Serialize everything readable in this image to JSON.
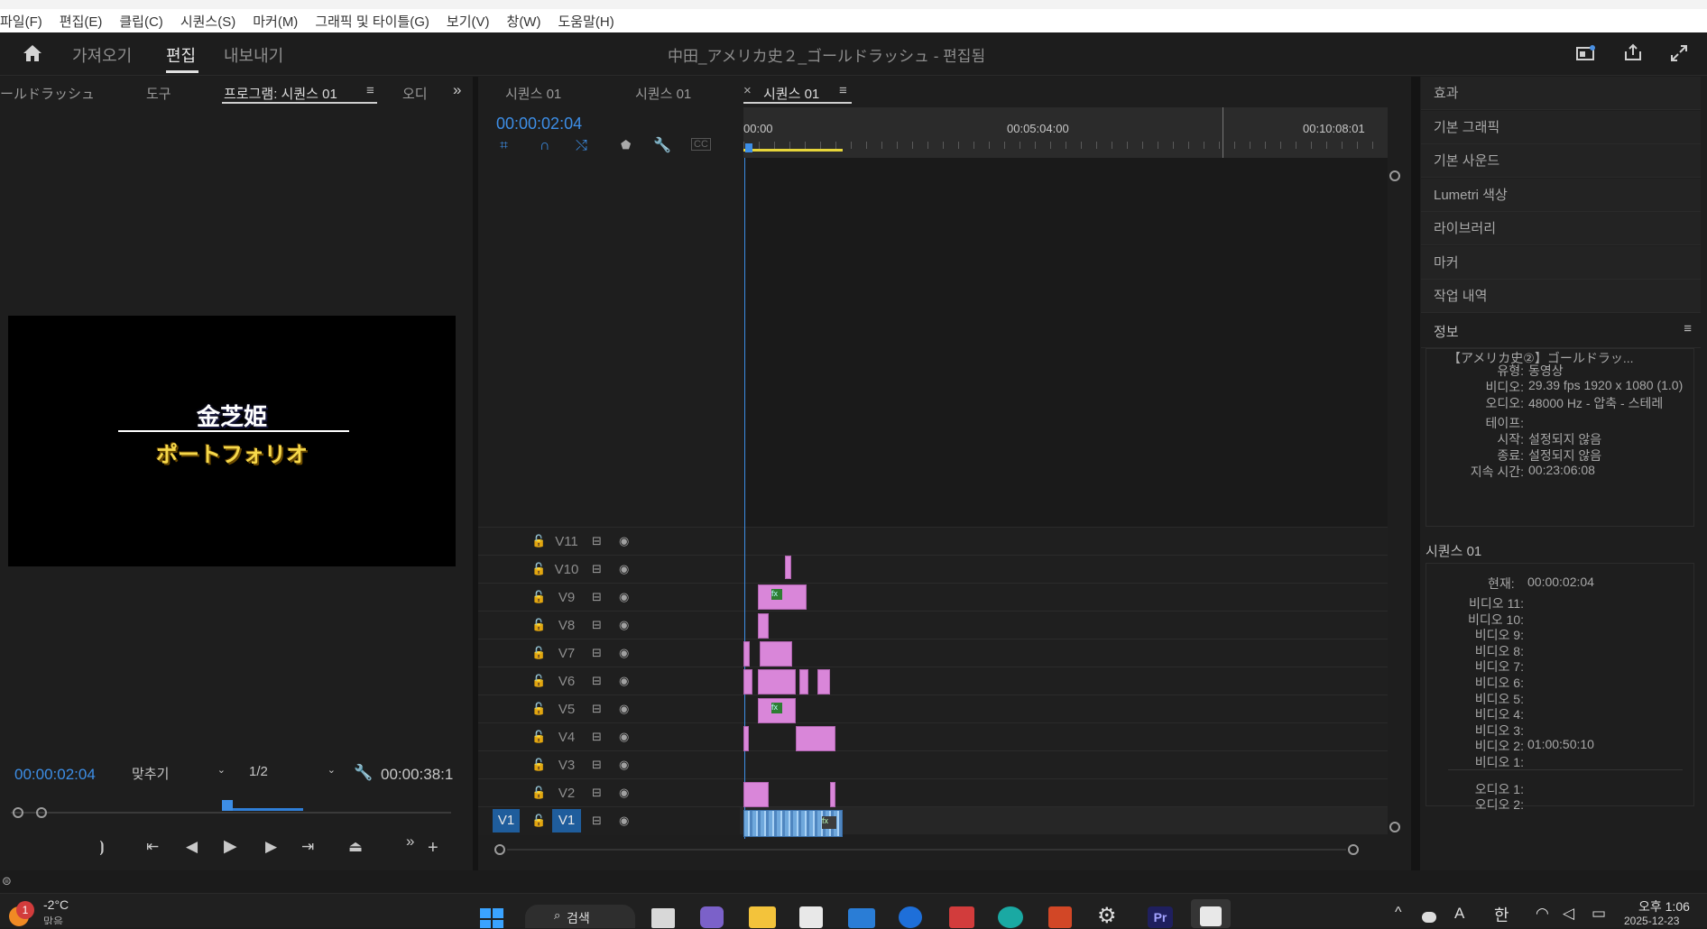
{
  "menu": [
    "파일(F)",
    "편집(E)",
    "클립(C)",
    "시퀀스(S)",
    "마커(M)",
    "그래픽 및 타이틀(G)",
    "보기(V)",
    "창(W)",
    "도움말(H)"
  ],
  "header": {
    "tabs": [
      "가져오기",
      "편집",
      "내보내기"
    ],
    "title": "中田_アメリカ史２_ゴールドラッシュ",
    "title_suffix": " - 편집됨"
  },
  "left_panel": {
    "tabs": [
      "ールドラッシュ",
      "도구",
      "프로그램: 시퀀스 01",
      "오디"
    ],
    "overlay_name": "金芝姫",
    "overlay_sub": "ポートフォリオ",
    "timecode": "00:00:02:04",
    "fit": "맞추기",
    "resolution": "1/2",
    "duration": "00:00:38:1"
  },
  "timeline": {
    "tabs": [
      "시퀀스 01",
      "시퀀스 01",
      "시퀀스 01"
    ],
    "timecode": "00:00:02:04",
    "ruler": [
      "00:00",
      "00:05:04:00",
      "00:10:08:01"
    ],
    "tracks": [
      "V11",
      "V10",
      "V9",
      "V8",
      "V7",
      "V6",
      "V5",
      "V4",
      "V3",
      "V2",
      "V1"
    ],
    "source_label": "V1"
  },
  "right_panel": {
    "items": [
      "효과",
      "기본 그래픽",
      "기본 사운드",
      "Lumetri 색상",
      "라이브러리",
      "마커",
      "작업 내역"
    ],
    "info_title": "정보",
    "info": {
      "clip_name": "【アメリカ史②】ゴールドラッ...",
      "rows": [
        {
          "k": "유형:",
          "v": "동영상"
        },
        {
          "k": "비디오:",
          "v": "29.39 fps 1920 x 1080 (1.0)"
        },
        {
          "k": "오디오:",
          "v": "48000 Hz - 압축 - 스테레"
        },
        {
          "k": "테이프:",
          "v": ""
        },
        {
          "k": "시작:",
          "v": "설정되지 않음"
        },
        {
          "k": "종료:",
          "v": "설정되지 않음"
        },
        {
          "k": "지속 시간:",
          "v": "00:23:06:08"
        }
      ]
    },
    "seq_title": "시퀀스 01",
    "seq": {
      "current_label": "현재:",
      "current": "00:00:02:04",
      "rows": [
        {
          "k": "비디오 11:",
          "v": ""
        },
        {
          "k": "비디오 10:",
          "v": ""
        },
        {
          "k": "비디오 9:",
          "v": ""
        },
        {
          "k": "비디오 8:",
          "v": ""
        },
        {
          "k": "비디오 7:",
          "v": ""
        },
        {
          "k": "비디오 6:",
          "v": ""
        },
        {
          "k": "비디오 5:",
          "v": ""
        },
        {
          "k": "비디오 4:",
          "v": ""
        },
        {
          "k": "비디오 3:",
          "v": ""
        },
        {
          "k": "비디오 2:",
          "v": "01:00:50:10"
        },
        {
          "k": "비디오 1:",
          "v": ""
        },
        {
          "k": "오디오 1:",
          "v": ""
        },
        {
          "k": "오디오 2:",
          "v": ""
        }
      ]
    }
  },
  "taskbar": {
    "weather": "-2°C",
    "weather_sub": "맑음",
    "badge": "1",
    "search": "검색",
    "ime": "A",
    "lang": "한",
    "time": "오후 1:06",
    "date": "2025-12-23"
  }
}
